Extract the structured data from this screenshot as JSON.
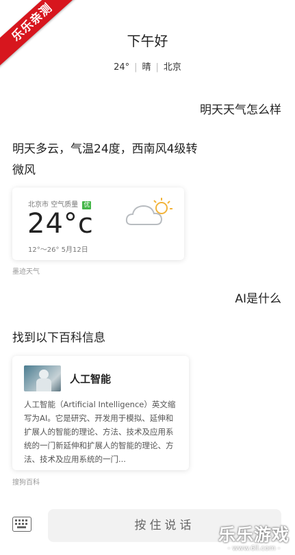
{
  "ribbon": {
    "text": "乐乐亲测"
  },
  "header": {
    "greeting": "下午好",
    "temperature": "24°",
    "condition": "晴",
    "city": "北京"
  },
  "messages": {
    "user_1": "明天天气怎么样",
    "bot_1": "明天多云，气温24度，西南风4级转微风",
    "user_2": "AI是什么",
    "bot_2": "找到以下百科信息"
  },
  "weather_card": {
    "city": "北京市",
    "air_quality_label": "空气质量",
    "air_quality_value": "优",
    "temperature": "24°c",
    "range": "12°～26°",
    "date": "5月12日",
    "icon": "partly-cloudy-icon",
    "source": "墨迹天气"
  },
  "baike_card": {
    "title": "人工智能",
    "text": "人工智能（Artificial Intelligence）英文缩写为AI。它是研究、开发用于模拟、延伸和扩展人的智能的理论、方法、技术及应用系统的一门新延伸和扩展人的智能的理论、方法、技术及应用系统的一门...",
    "source": "搜狗百科"
  },
  "input_bar": {
    "keyboard_icon": "keyboard-icon",
    "talk_label": "按住说话"
  },
  "watermark": {
    "main": "乐乐游戏",
    "url": "- www.6ll.com -"
  }
}
